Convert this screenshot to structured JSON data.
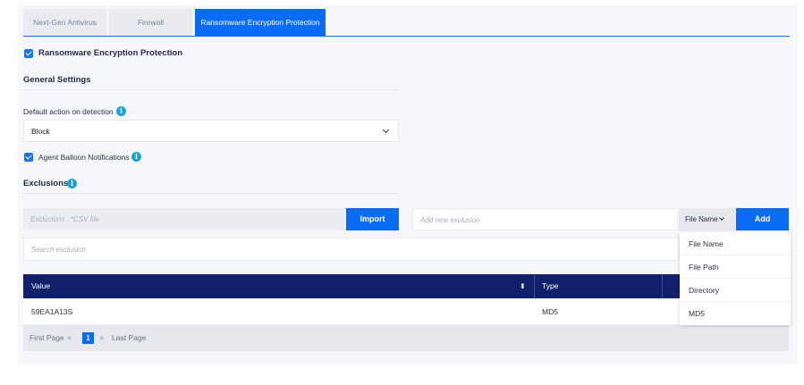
{
  "tabs": [
    {
      "label": "Next-Gen Antivirus",
      "active": false
    },
    {
      "label": "Firewall",
      "active": false
    },
    {
      "label": "Ransomware Encryption Protection",
      "active": true
    }
  ],
  "feature": {
    "checked": true,
    "label": "Ransomware Encryption Protection"
  },
  "general": {
    "title": "General Settings",
    "default_action_label": "Default action on detection",
    "default_action_value": "Block",
    "balloon_checked": true,
    "balloon_label": "Agent Balloon Notifications"
  },
  "exclusions": {
    "title": "Exclusions",
    "import_placeholder": "Exclusions , *CSV file",
    "import_button": "Import",
    "new_placeholder": "Add new exclusion",
    "type_selected": "File Name",
    "add_button": "Add",
    "search_placeholder": "Search exclusion",
    "type_options": [
      "File Name",
      "File Path",
      "Directory",
      "MD5"
    ]
  },
  "table": {
    "columns": [
      "Value",
      "Type"
    ],
    "rows": [
      {
        "value": "59EA1A13S",
        "type": "MD5"
      }
    ]
  },
  "pagination": {
    "first": "First Page",
    "current": "1",
    "last": "Last Page"
  },
  "colors": {
    "accent": "#0a6cf5",
    "header": "#10206b",
    "info": "#1aa2d8"
  }
}
